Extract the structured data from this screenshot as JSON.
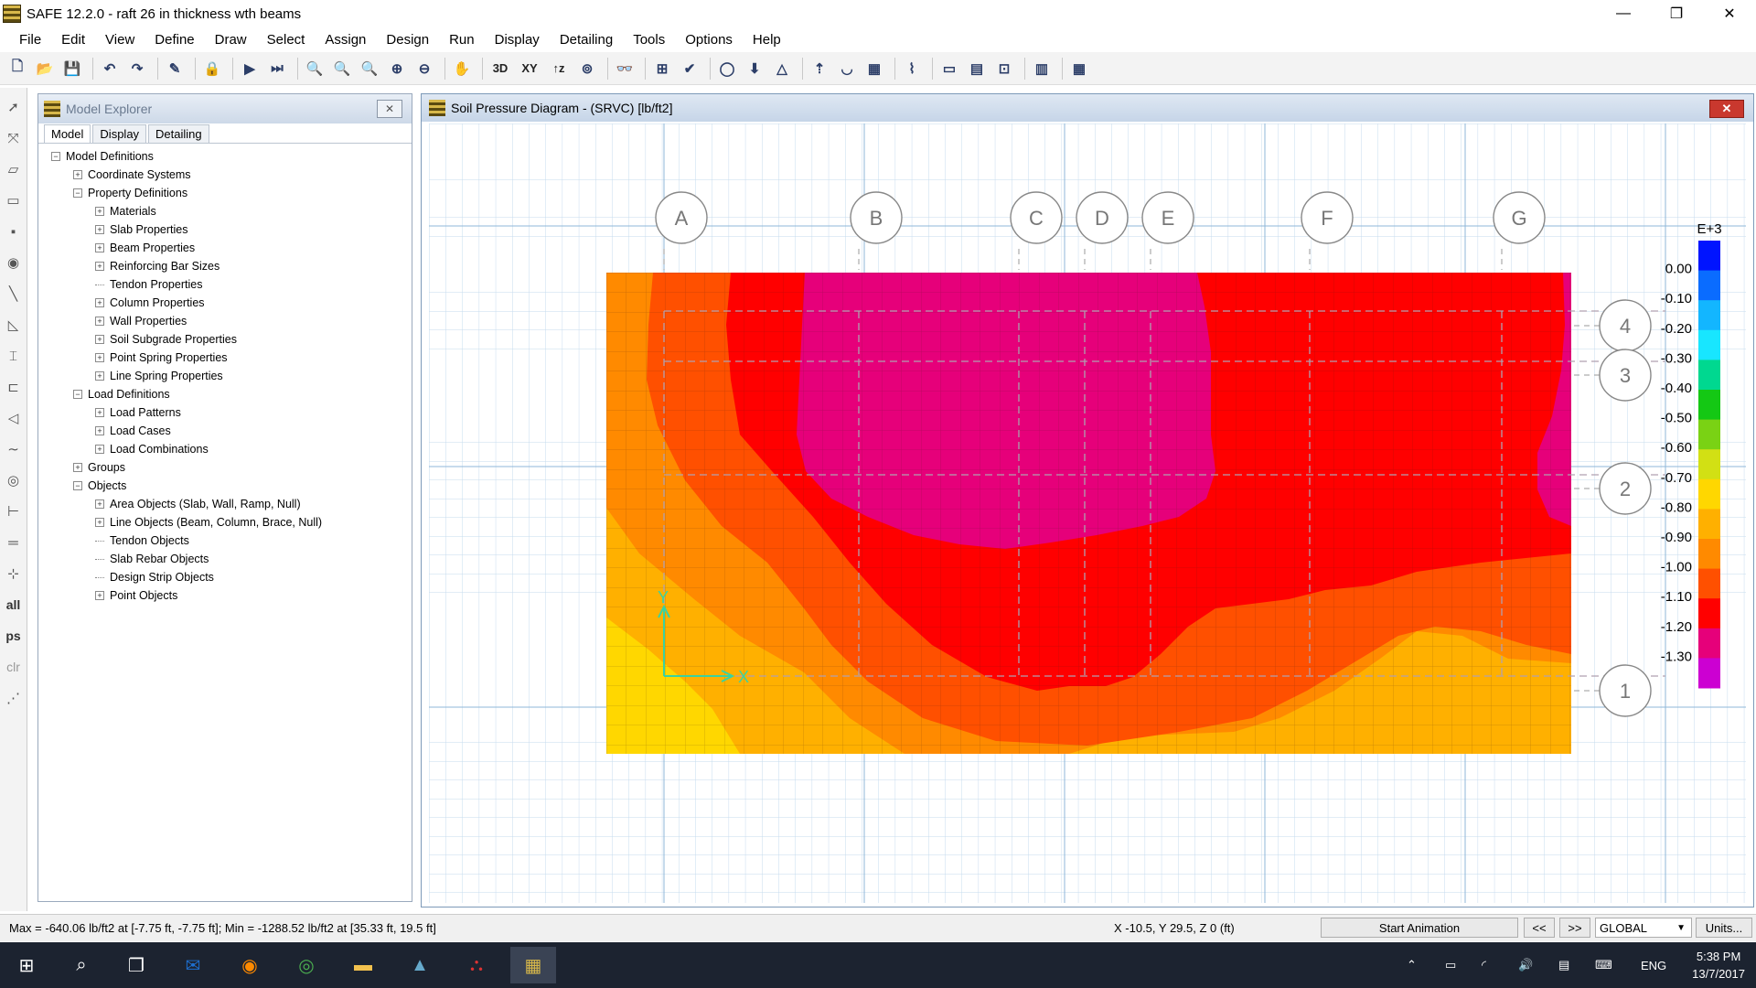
{
  "window": {
    "title": "SAFE 12.2.0 - raft 26 in thickness wth beams",
    "minimize": "—",
    "restore": "❐",
    "close": "✕"
  },
  "menus": [
    "File",
    "Edit",
    "View",
    "Define",
    "Draw",
    "Select",
    "Assign",
    "Design",
    "Run",
    "Display",
    "Detailing",
    "Tools",
    "Options",
    "Help"
  ],
  "toolbar": {
    "view_3d": "3D",
    "view_xy": "XY",
    "view_z": "↑z"
  },
  "sidetools": {
    "all": "all",
    "ps": "ps",
    "clr": "clr"
  },
  "explorer": {
    "title": "Model Explorer",
    "close": "✕",
    "tabs": [
      "Model",
      "Display",
      "Detailing"
    ],
    "tree": [
      {
        "label": "Model Definitions",
        "level": 0,
        "expander": "−"
      },
      {
        "label": "Coordinate Systems",
        "level": 1,
        "expander": "+"
      },
      {
        "label": "Property Definitions",
        "level": 1,
        "expander": "−"
      },
      {
        "label": "Materials",
        "level": 2,
        "expander": "+"
      },
      {
        "label": "Slab Properties",
        "level": 2,
        "expander": "+"
      },
      {
        "label": "Beam Properties",
        "level": 2,
        "expander": "+"
      },
      {
        "label": "Reinforcing Bar Sizes",
        "level": 2,
        "expander": "+"
      },
      {
        "label": "Tendon Properties",
        "level": 2,
        "expander": ""
      },
      {
        "label": "Column Properties",
        "level": 2,
        "expander": "+"
      },
      {
        "label": "Wall Properties",
        "level": 2,
        "expander": "+"
      },
      {
        "label": "Soil Subgrade Properties",
        "level": 2,
        "expander": "+"
      },
      {
        "label": "Point Spring Properties",
        "level": 2,
        "expander": "+"
      },
      {
        "label": "Line Spring Properties",
        "level": 2,
        "expander": "+"
      },
      {
        "label": "Load Definitions",
        "level": 1,
        "expander": "−"
      },
      {
        "label": "Load Patterns",
        "level": 2,
        "expander": "+"
      },
      {
        "label": "Load Cases",
        "level": 2,
        "expander": "+"
      },
      {
        "label": "Load Combinations",
        "level": 2,
        "expander": "+"
      },
      {
        "label": "Groups",
        "level": 1,
        "expander": "+"
      },
      {
        "label": "Objects",
        "level": 1,
        "expander": "−"
      },
      {
        "label": "Area Objects (Slab, Wall, Ramp, Null)",
        "level": 2,
        "expander": "+"
      },
      {
        "label": "Line Objects (Beam, Column, Brace, Null)",
        "level": 2,
        "expander": "+"
      },
      {
        "label": "Tendon Objects",
        "level": 2,
        "expander": ""
      },
      {
        "label": "Slab Rebar Objects",
        "level": 2,
        "expander": ""
      },
      {
        "label": "Design Strip Objects",
        "level": 2,
        "expander": ""
      },
      {
        "label": "Point Objects",
        "level": 2,
        "expander": "+"
      }
    ]
  },
  "diagram": {
    "title": "Soil Pressure Diagram - (SRVC)  [lb/ft2]",
    "close": "✕",
    "grid_x_labels": [
      "A",
      "B",
      "C",
      "D",
      "E",
      "F",
      "G"
    ],
    "grid_y_labels": [
      "4",
      "3",
      "2",
      "1"
    ],
    "axis_x": "X",
    "axis_y": "Y",
    "legend": {
      "exponent": "E+3",
      "ticks": [
        "0.00",
        "-0.10",
        "-0.20",
        "-0.30",
        "-0.40",
        "-0.50",
        "-0.60",
        "-0.70",
        "-0.80",
        "-0.90",
        "-1.00",
        "-1.10",
        "-1.20",
        "-1.30"
      ],
      "colors": [
        "#0014ff",
        "#0a6cff",
        "#13b6ff",
        "#18e6ff",
        "#00d890",
        "#14c814",
        "#7ad214",
        "#d2e014",
        "#ffd700",
        "#ffb000",
        "#ff8a00",
        "#ff5000",
        "#ff0000",
        "#e6007a",
        "#cc00d2"
      ]
    }
  },
  "status": {
    "message": "Max = -640.06 lb/ft2 at [-7.75 ft, -7.75 ft];  Min = -1288.52 lb/ft2 at [35.33 ft, 19.5 ft]",
    "coords": "X -10.5,  Y 29.5,  Z 0  (ft)",
    "start_animation": "Start Animation",
    "prev": "<<",
    "next": ">>",
    "coord_system": "GLOBAL",
    "units": "Units..."
  },
  "taskbar": {
    "language": "ENG",
    "time": "5:38 PM",
    "date": "13/7/2017"
  }
}
